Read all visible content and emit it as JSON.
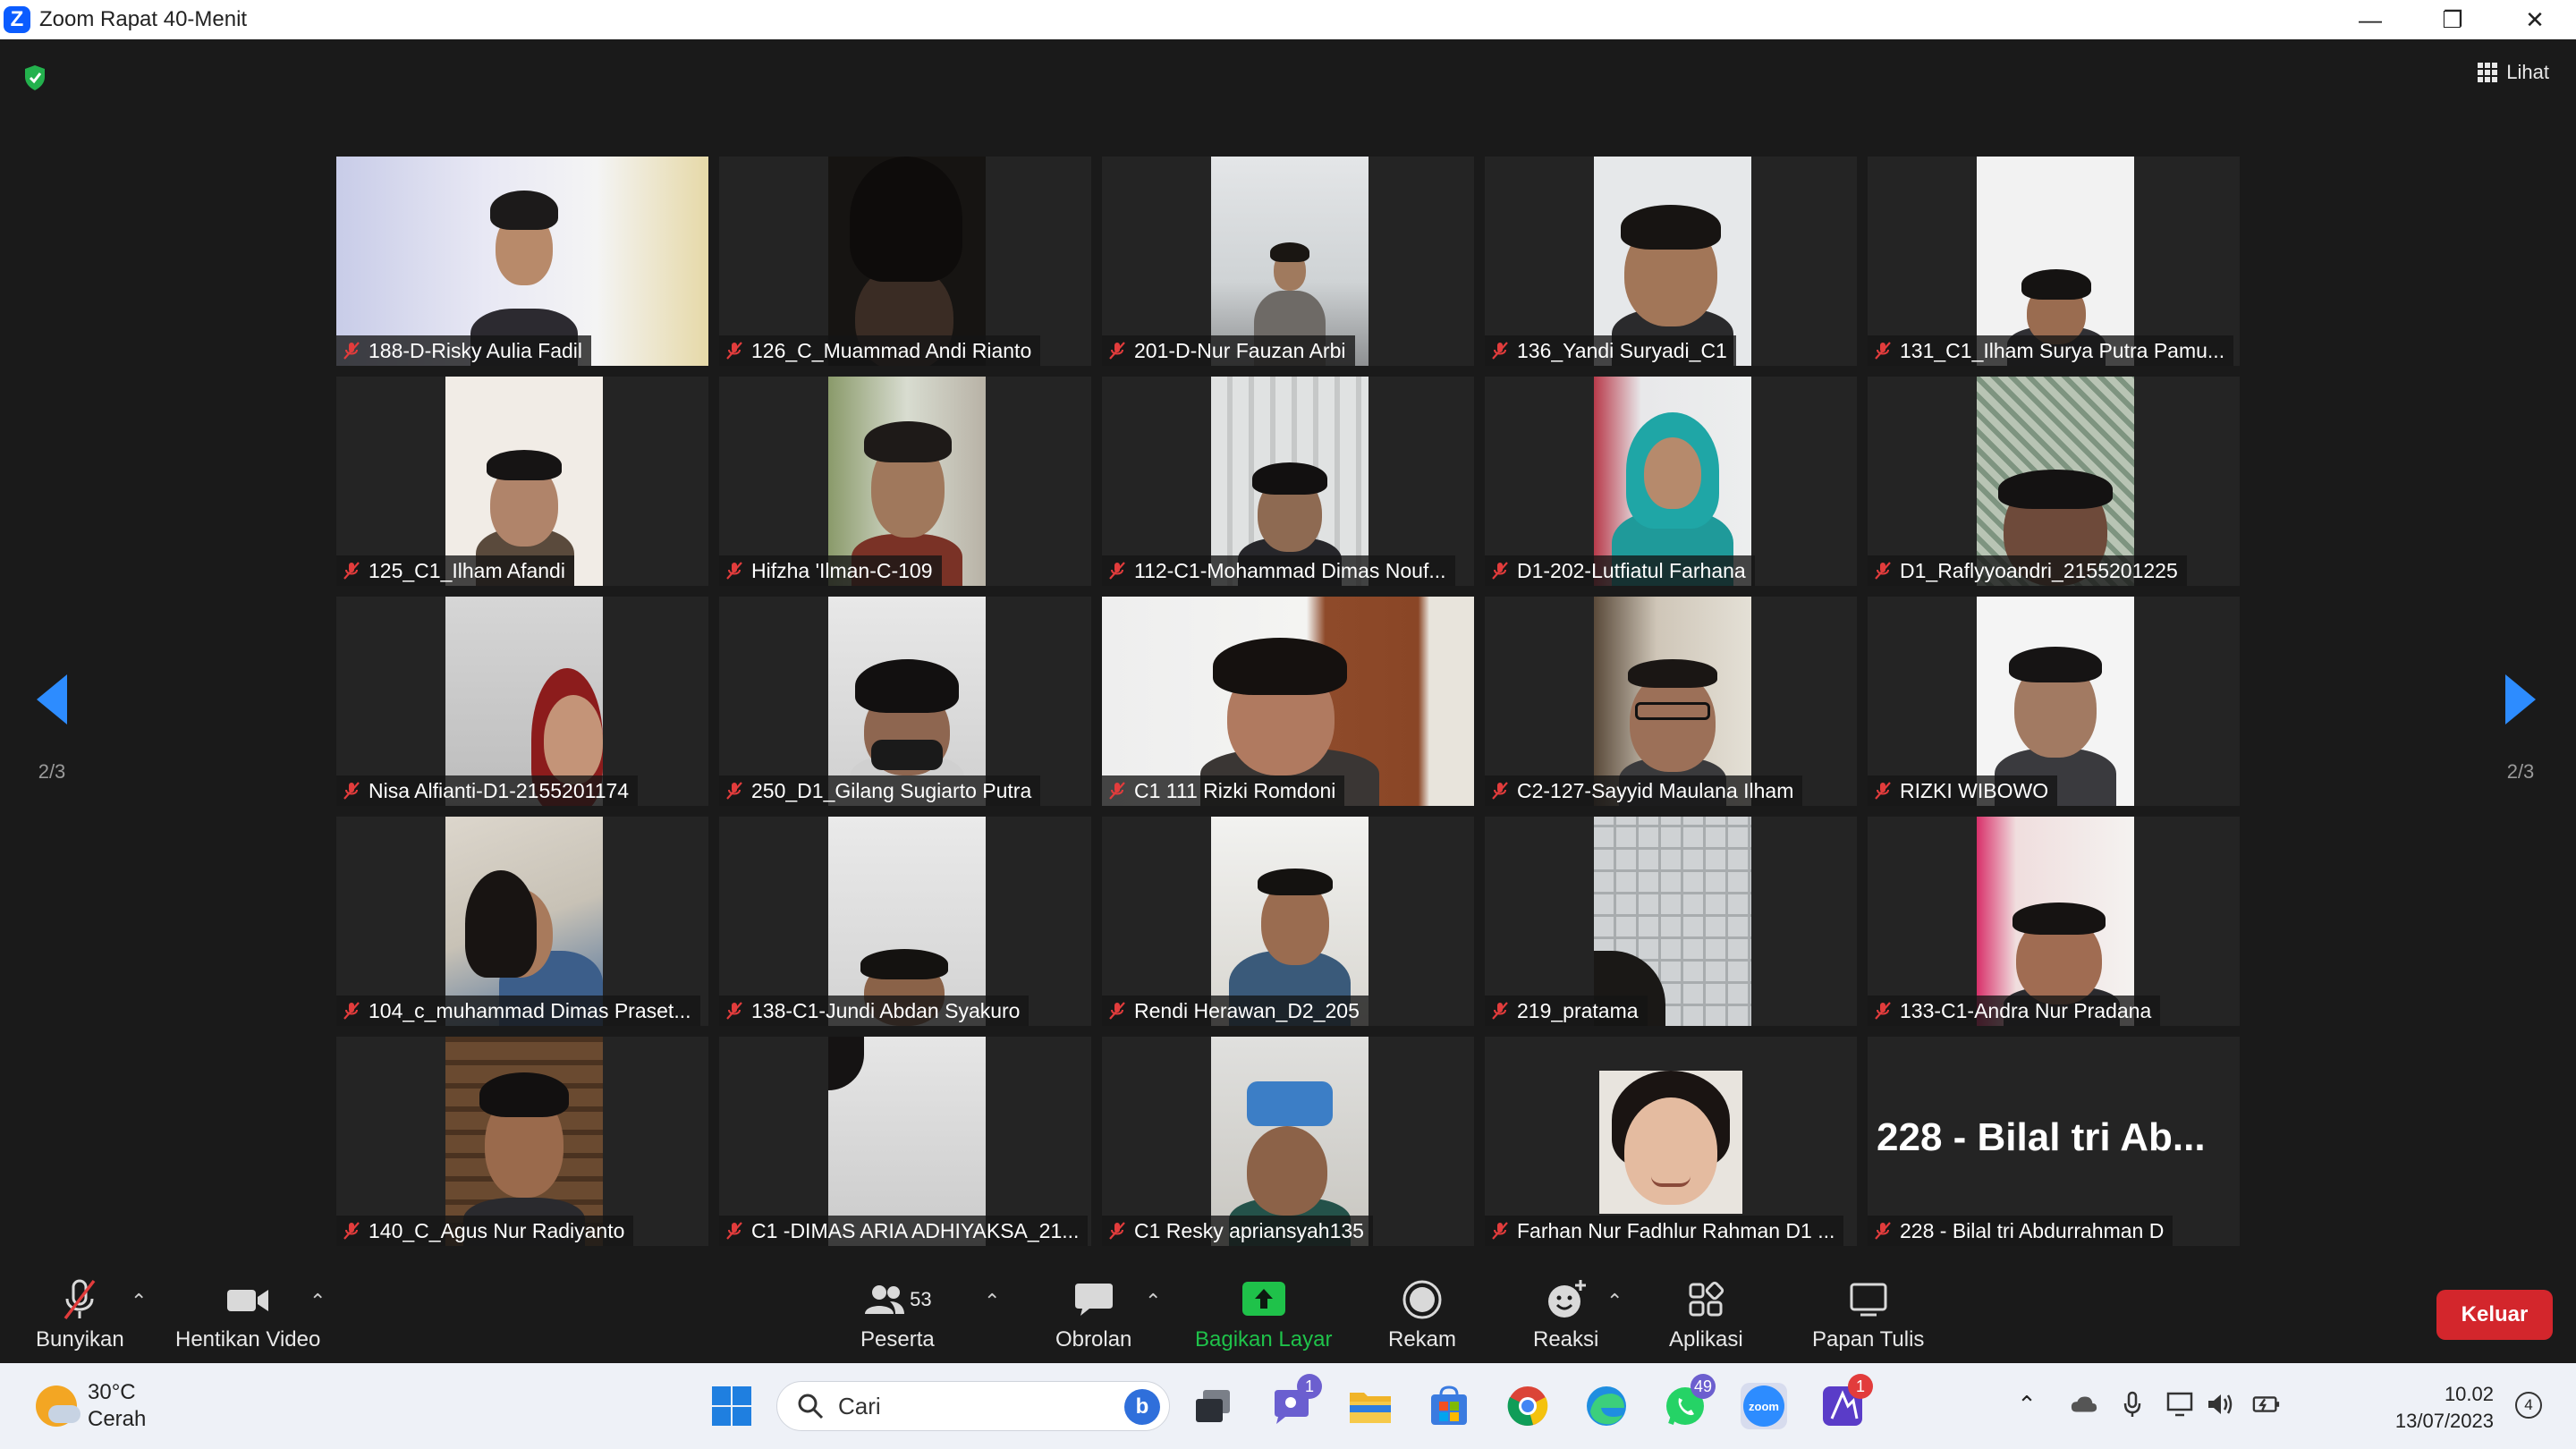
{
  "window": {
    "title": "Zoom Rapat 40-Menit",
    "view_label": "Lihat"
  },
  "pager": {
    "page_left": "2/3",
    "page_right": "2/3"
  },
  "participants": [
    {
      "name": "188-D-Risky Aulia Fadil"
    },
    {
      "name": "126_C_Muammad Andi Rianto"
    },
    {
      "name": "201-D-Nur Fauzan Arbi"
    },
    {
      "name": "136_Yandi Suryadi_C1"
    },
    {
      "name": "131_C1_Ilham Surya Putra Pamu..."
    },
    {
      "name": "125_C1_Ilham Afandi"
    },
    {
      "name": "Hifzha 'Ilman-C-109"
    },
    {
      "name": "112-C1-Mohammad Dimas Nouf..."
    },
    {
      "name": "D1-202-Lutfiatul Farhana"
    },
    {
      "name": "D1_Raflyyoandri_2155201225"
    },
    {
      "name": "Nisa Alfianti-D1-2155201174"
    },
    {
      "name": "250_D1_Gilang Sugiarto Putra"
    },
    {
      "name": "C1 111 Rizki Romdoni"
    },
    {
      "name": "C2-127-Sayyid Maulana Ilham"
    },
    {
      "name": "RIZKI WIBOWO"
    },
    {
      "name": "104_c_muhammad Dimas Praset..."
    },
    {
      "name": "138-C1-Jundi Abdan Syakuro"
    },
    {
      "name": "Rendi Herawan_D2_205"
    },
    {
      "name": "219_pratama"
    },
    {
      "name": "133-C1-Andra Nur Pradana"
    },
    {
      "name": "140_C_Agus Nur Radiyanto"
    },
    {
      "name": "C1 -DIMAS ARIA ADHIYAKSA_21..."
    },
    {
      "name": "C1 Resky apriansyah135"
    },
    {
      "name": "Farhan Nur Fadhlur Rahman D1 ..."
    },
    {
      "name": "228 - Bilal tri Abdurrahman D",
      "display_name": "228 - Bilal tri Ab..."
    }
  ],
  "toolbar": {
    "unmute": "Bunyikan",
    "stop_video": "Hentikan Video",
    "participants": "Peserta",
    "participants_count": "53",
    "chat": "Obrolan",
    "share_screen": "Bagikan Layar",
    "record": "Rekam",
    "reactions": "Reaksi",
    "apps": "Aplikasi",
    "whiteboard": "Papan Tulis",
    "leave": "Keluar"
  },
  "taskbar": {
    "weather_temp": "30°C",
    "weather_desc": "Cerah",
    "search_placeholder": "Cari",
    "teams_badge": "1",
    "whatsapp_badge": "49",
    "app_badge": "1",
    "time": "10.02",
    "date": "13/07/2023",
    "notifications": "4"
  },
  "colors": {
    "share_green": "#1fc24a",
    "leave_red": "#d3262c",
    "pager_blue": "#2d8cff"
  }
}
